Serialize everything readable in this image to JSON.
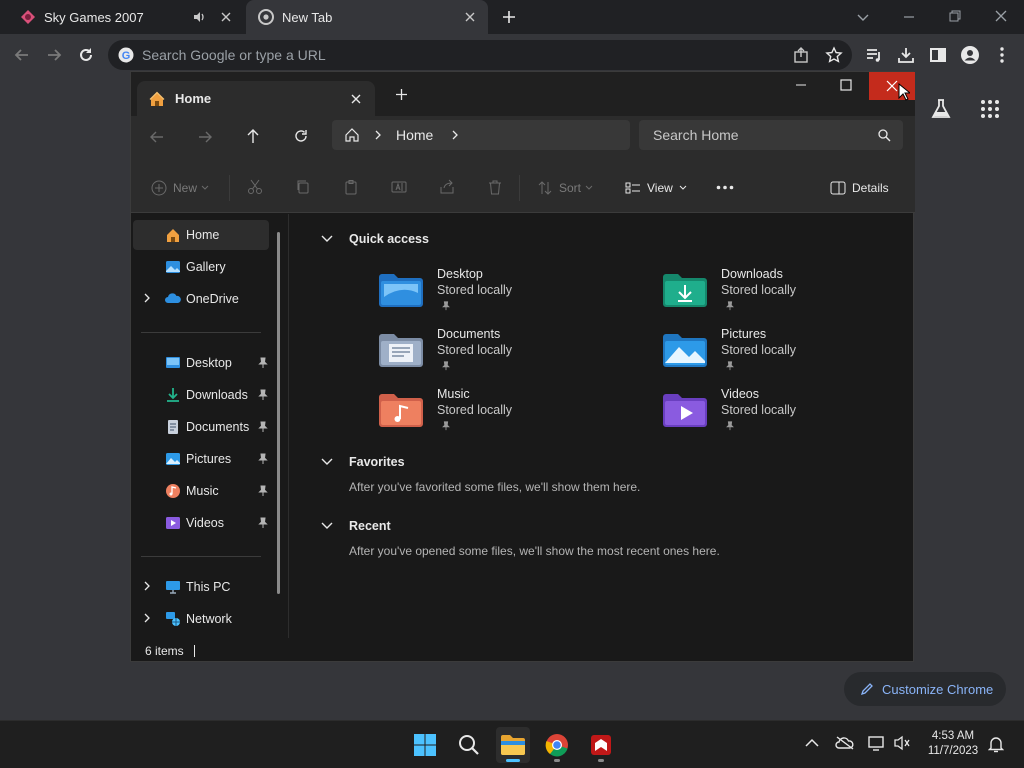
{
  "browser": {
    "tabs": [
      {
        "title": "Sky Games 2007",
        "icon": "sky-games-favicon"
      },
      {
        "title": "New Tab",
        "icon": "chrome-favicon"
      }
    ],
    "omnibox_placeholder": "Search Google or type a URL",
    "customize_label": "Customize Chrome"
  },
  "explorer": {
    "tab_title": "Home",
    "breadcrumb": "Home",
    "search_placeholder": "Search Home",
    "commands": {
      "new": "New",
      "sort": "Sort",
      "view": "View",
      "details": "Details"
    },
    "nav": {
      "top": [
        {
          "label": "Home",
          "icon": "home-icon"
        },
        {
          "label": "Gallery",
          "icon": "gallery-icon"
        },
        {
          "label": "OneDrive",
          "icon": "onedrive-icon"
        }
      ],
      "pinned": [
        {
          "label": "Desktop",
          "icon": "desktop-folder-icon"
        },
        {
          "label": "Downloads",
          "icon": "downloads-folder-icon"
        },
        {
          "label": "Documents",
          "icon": "documents-folder-icon"
        },
        {
          "label": "Pictures",
          "icon": "pictures-folder-icon"
        },
        {
          "label": "Music",
          "icon": "music-folder-icon"
        },
        {
          "label": "Videos",
          "icon": "videos-folder-icon"
        }
      ],
      "bottom": [
        {
          "label": "This PC",
          "icon": "this-pc-icon"
        },
        {
          "label": "Network",
          "icon": "network-icon"
        }
      ]
    },
    "sections": {
      "quick_access": "Quick access",
      "favorites": "Favorites",
      "favorites_empty": "After you've favorited some files, we'll show them here.",
      "recent": "Recent",
      "recent_empty": "After you've opened some files, we'll show the most recent ones here."
    },
    "quick_access_items": [
      {
        "name": "Desktop",
        "status": "Stored locally",
        "color": "#2f8fe0"
      },
      {
        "name": "Downloads",
        "status": "Stored locally",
        "color": "#1fae8c"
      },
      {
        "name": "Documents",
        "status": "Stored locally",
        "color": "#9fb0c8"
      },
      {
        "name": "Pictures",
        "status": "Stored locally",
        "color": "#2d9ae8"
      },
      {
        "name": "Music",
        "status": "Stored locally",
        "color": "#ee8060"
      },
      {
        "name": "Videos",
        "status": "Stored locally",
        "color": "#8a5be0"
      }
    ],
    "status_bar": "6 items"
  },
  "taskbar": {
    "time": "4:53 AM",
    "date": "11/7/2023"
  },
  "colors": {
    "close_hover": "#c42b1c",
    "accent": "#4cc2ff"
  }
}
